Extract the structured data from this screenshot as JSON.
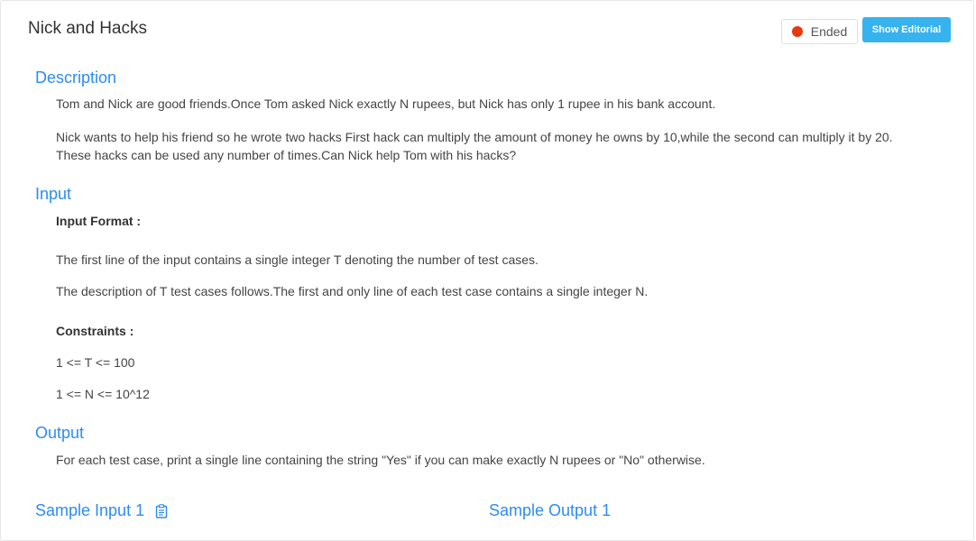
{
  "problem": {
    "title": "Nick and Hacks",
    "status": "Ended",
    "editorial_button": "Show Editorial"
  },
  "description": {
    "heading": "Description",
    "para1": "Tom and Nick are good friends.Once Tom asked Nick exactly N rupees, but Nick has only 1 rupee in his bank account.",
    "para2_line1": "Nick wants to help his friend so he wrote two hacks First hack can multiply the amount of money he owns by 10,while the second can multiply it by 20.",
    "para2_line2": "These hacks can be used any number of times.Can Nick help Tom with his hacks?"
  },
  "input": {
    "heading": "Input",
    "format_label": "Input Format :",
    "line1": "The first line of the input contains a single integer T denoting the number of test cases.",
    "line2": "The description of T test cases follows.The first and only line of each test case contains a single integer N.",
    "constraints_label": "Constraints :",
    "constraint1": "1 <= T <= 100",
    "constraint2": "1 <= N <= 10^12"
  },
  "output": {
    "heading": "Output",
    "line1": "For each test case, print a single line containing the string \"Yes\" if you can make exactly N rupees or \"No\" otherwise."
  },
  "samples": {
    "input_heading": "Sample Input 1",
    "output_heading": "Sample Output 1"
  },
  "colors": {
    "accent": "#2d8cf0",
    "button": "#36b3ee",
    "status_dot": "#e8380d"
  }
}
